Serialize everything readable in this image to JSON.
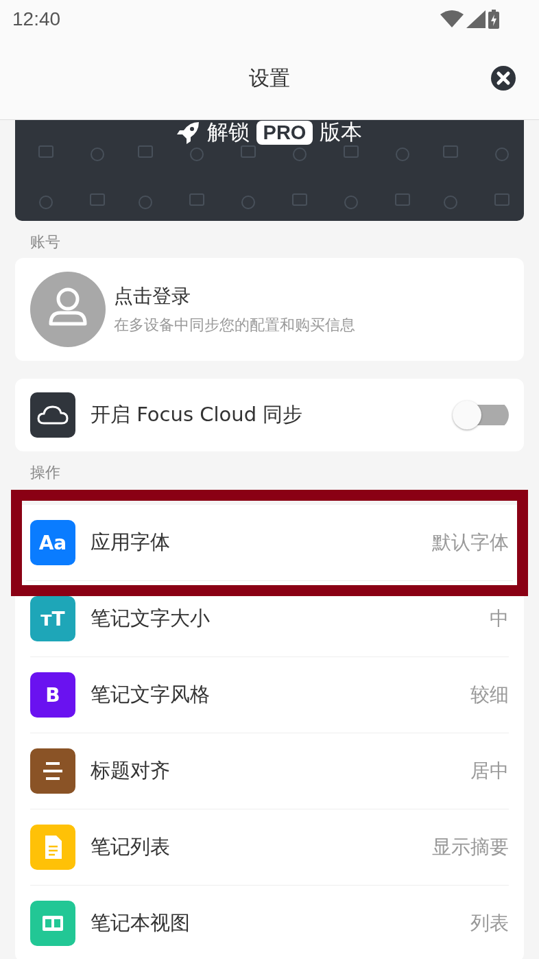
{
  "status_bar": {
    "time": "12:40"
  },
  "header": {
    "title": "设置"
  },
  "banner": {
    "text_before": "解锁",
    "badge": "PRO",
    "text_after": "版本"
  },
  "account": {
    "section_label": "账号",
    "title": "点击登录",
    "subtitle": "在多设备中同步您的配置和购买信息"
  },
  "sync": {
    "label": "开启 Focus Cloud 同步",
    "on": false
  },
  "operations": {
    "section_label": "操作",
    "items": [
      {
        "icon_text": "Aa",
        "color": "#0a7cff",
        "label": "应用字体",
        "value": "默认字体",
        "highlighted": true
      },
      {
        "icon_text": "ᴛT",
        "color": "#1ea6b8",
        "label": "笔记文字大小",
        "value": "中",
        "highlighted": false
      },
      {
        "icon_text": "B",
        "color": "#6a12f0",
        "label": "笔记文字风格",
        "value": "较细",
        "highlighted": false
      },
      {
        "kind": "align",
        "color": "#8a5326",
        "label": "标题对齐",
        "value": "居中",
        "highlighted": false
      },
      {
        "kind": "document",
        "color": "#ffc107",
        "label": "笔记列表",
        "value": "显示摘要",
        "highlighted": false
      },
      {
        "kind": "columns",
        "color": "#22c795",
        "label": "笔记本视图",
        "value": "列表",
        "highlighted": false
      }
    ]
  }
}
